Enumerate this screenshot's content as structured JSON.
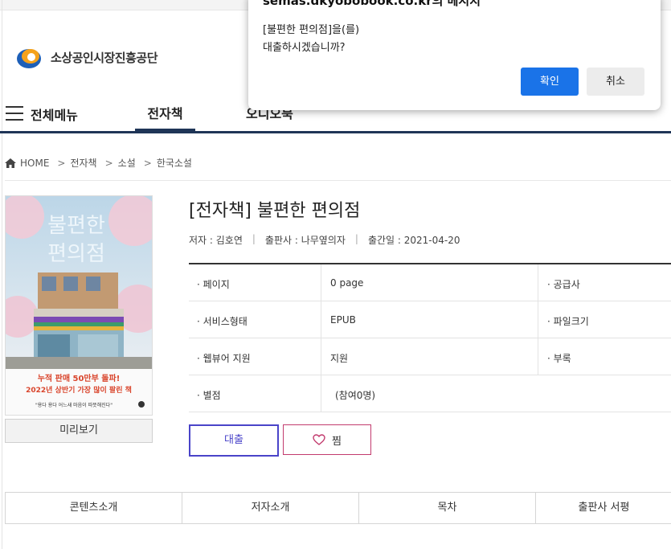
{
  "site": {
    "org_name": "소상공인시장진흥공단"
  },
  "nav": {
    "all_menu": "전체메뉴",
    "tab_ebook": "전자책",
    "tab_audiobook": "오디오북"
  },
  "breadcrumb": [
    "HOME",
    "전자책",
    "소설",
    "한국소설"
  ],
  "book": {
    "title": "[전자책] 불편한 편의점",
    "author": "저자 : 김호연",
    "publisher": "출판사 : 나무옆의자",
    "pub_date": "출간일 : 2021-04-20",
    "cover": {
      "title_text": "불편한 편의점",
      "promo_line1": "누적 판매 50만부 돌파!",
      "promo_line2": "2022년 상반기 가장 많이 팔린 책",
      "promo_line3": "\"용다 용다 어느새 마음이 따뜻해진다\""
    }
  },
  "preview_button": "미리보기",
  "info": [
    {
      "label": "· 페이지",
      "value": "0 page",
      "label2": "· 공급사"
    },
    {
      "label": "· 서비스형태",
      "value": "EPUB",
      "label2": "· 파일크기"
    },
    {
      "label": "· 웹뷰어 지원",
      "value": "지원",
      "label2": "· 부록"
    },
    {
      "label": "· 별점",
      "value": "(참여0명)",
      "label2": ""
    }
  ],
  "actions": {
    "borrow": "대출",
    "wish": "찜"
  },
  "bottom_tabs": [
    "콘텐츠소개",
    "저자소개",
    "목차",
    "출판사 서평"
  ],
  "dialog": {
    "title": "semas.dkyobobook.co.kr의 메시지",
    "message_line1": "[불편한 편의점]을(를)",
    "message_line2": "대출하시겠습니까?",
    "ok": "확인",
    "cancel": "취소"
  },
  "colors": {
    "nav_accent": "#1f3557",
    "borrow_border": "#4a44c9",
    "wish_border": "#c23b6e",
    "dialog_ok": "#1a73e8"
  }
}
